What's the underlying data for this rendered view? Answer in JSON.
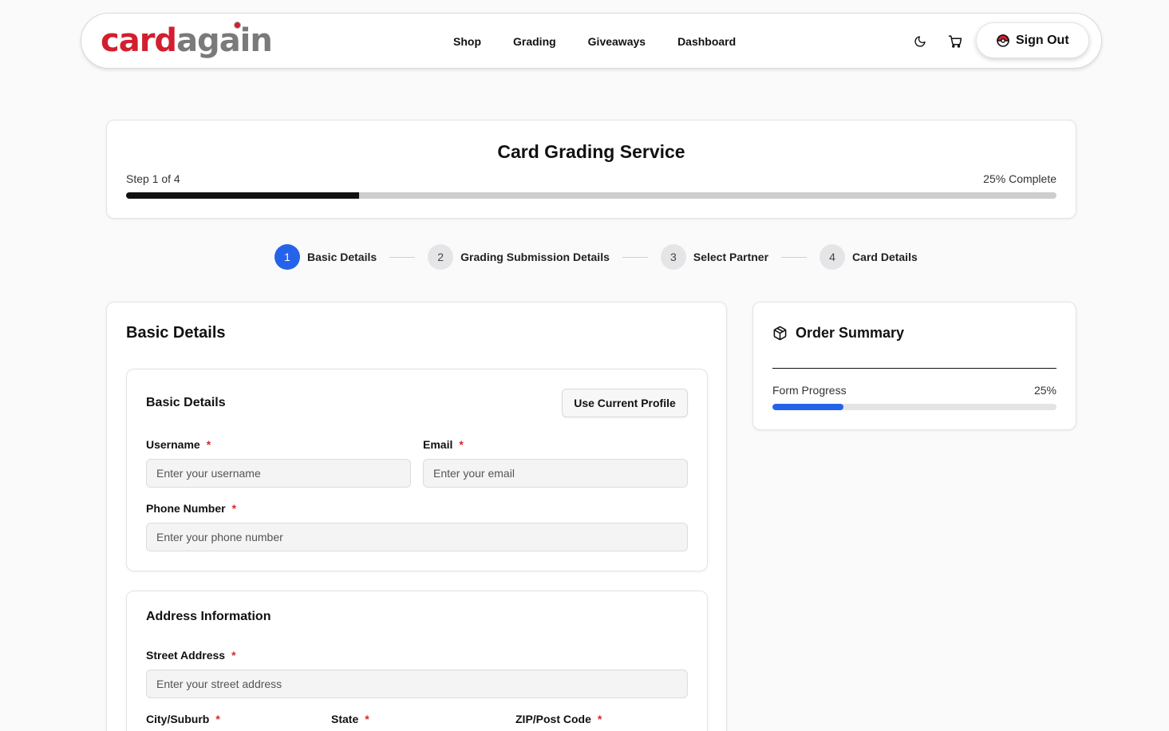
{
  "header": {
    "logo_part1": "card",
    "logo_part2": "again",
    "nav": [
      "Shop",
      "Grading",
      "Giveaways",
      "Dashboard"
    ],
    "sign_out_label": "Sign Out",
    "icons": {
      "theme": "moon-icon",
      "cart": "cart-icon",
      "sign_out": "pokeball-icon"
    }
  },
  "progress": {
    "title": "Card Grading Service",
    "step_text": "Step 1 of 4",
    "complete_text": "25% Complete",
    "fraction": 0.25
  },
  "stepper": [
    {
      "num": "1",
      "label": "Basic Details",
      "active": true
    },
    {
      "num": "2",
      "label": "Grading Submission Details",
      "active": false
    },
    {
      "num": "3",
      "label": "Select Partner",
      "active": false
    },
    {
      "num": "4",
      "label": "Card Details",
      "active": false
    }
  ],
  "form": {
    "title": "Basic Details",
    "basic": {
      "title": "Basic Details",
      "use_profile_label": "Use Current Profile",
      "username_label": "Username",
      "username_placeholder": "Enter your username",
      "email_label": "Email",
      "email_placeholder": "Enter your email",
      "phone_label": "Phone Number",
      "phone_placeholder": "Enter your phone number"
    },
    "address": {
      "title": "Address Information",
      "street_label": "Street Address",
      "street_placeholder": "Enter your street address",
      "city_label": "City/Suburb",
      "state_label": "State",
      "zip_label": "ZIP/Post Code"
    },
    "required_mark": "*"
  },
  "summary": {
    "title": "Order Summary",
    "form_progress_label": "Form Progress",
    "form_progress_pct": "25%",
    "fraction": 0.25
  },
  "colors": {
    "accent": "#2563eb",
    "brand_red": "#d21f2f",
    "required": "#dc2626"
  }
}
